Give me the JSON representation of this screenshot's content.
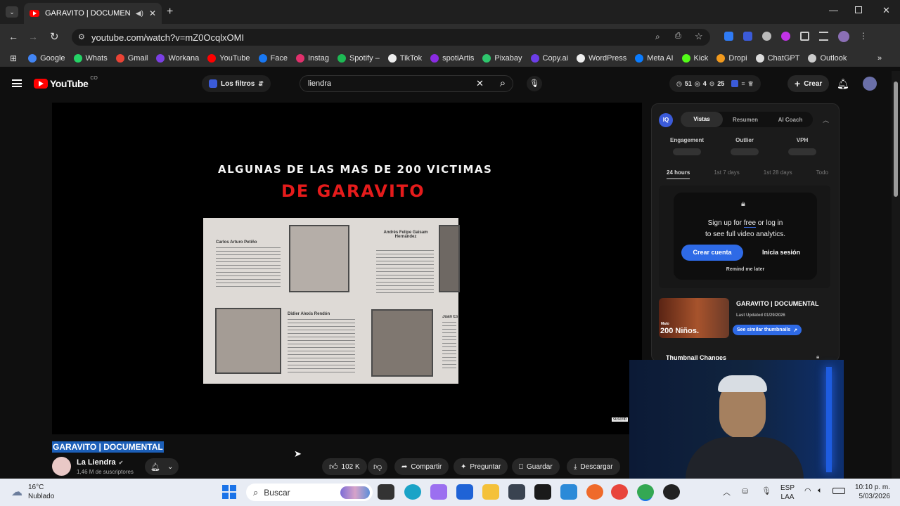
{
  "browser": {
    "tab_title": "GARAVITO | DOCUMENTAL",
    "url": "youtube.com/watch?v=mZ0OcqlxOMI",
    "bookmarks": [
      {
        "label": "Google",
        "color": "#4285f4"
      },
      {
        "label": "Whats",
        "color": "#25d366"
      },
      {
        "label": "Gmail",
        "color": "#ea4335"
      },
      {
        "label": "Workana",
        "color": "#7b3fe4"
      },
      {
        "label": "YouTube",
        "color": "#ff0000"
      },
      {
        "label": "Face",
        "color": "#1877f2"
      },
      {
        "label": "Instag",
        "color": "#e1306c"
      },
      {
        "label": "Spotify –",
        "color": "#1db954"
      },
      {
        "label": "TikTok",
        "color": "#eeeeee"
      },
      {
        "label": "spotiArtis",
        "color": "#8a2be2"
      },
      {
        "label": "Pixabay",
        "color": "#2ec66d"
      },
      {
        "label": "Copy.ai",
        "color": "#6c3ee8"
      },
      {
        "label": "WordPress",
        "color": "#eeeeee"
      },
      {
        "label": "Meta AI",
        "color": "#0a7cff"
      },
      {
        "label": "Kick",
        "color": "#53fc18"
      },
      {
        "label": "Dropi",
        "color": "#f29a1d"
      },
      {
        "label": "ChatGPT",
        "color": "#dddddd"
      },
      {
        "label": "Outlook",
        "color": "#cccccc"
      }
    ]
  },
  "youtube": {
    "logo_text": "YouTube",
    "logo_region": "CO",
    "filters_label": "Los filtros",
    "search_value": "liendra",
    "stats": {
      "a": "51",
      "b": "4",
      "c": "25"
    },
    "create_label": "Crear"
  },
  "video": {
    "overlay_line1": "ALGUNAS DE LAS MAS DE 200 VICTIMAS",
    "overlay_line2": "DE GARAVITO",
    "clip1_name": "Carlos Arturo Petiño",
    "clip2_name": "Andrés Felipe Gaisam Hernández",
    "clip3_name": "Didier Alexis Rendón",
    "clip4_name": "Juan Esteb",
    "watermark": "suscrib"
  },
  "below": {
    "title": "GARAVITO | DOCUMENTAL",
    "channel_name": "La Liendra",
    "subscribers": "1,46 M de suscriptores",
    "likes": "102 K",
    "share": "Compartir",
    "ask": "Preguntar",
    "save": "Guardar",
    "download": "Descargar"
  },
  "sidepanel": {
    "badge": "IQ",
    "tabs": [
      "Vistas",
      "Resumen",
      "AI Coach"
    ],
    "metrics": [
      "Engagement",
      "Outlier",
      "VPH"
    ],
    "ranges": [
      "24 hours",
      "1st 7 days",
      "1st 28 days",
      "Todo"
    ],
    "popup_line1_a": "Sign up for ",
    "popup_line1_b": "free",
    "popup_line1_c": " or log in",
    "popup_line2": "to see full video analytics.",
    "create_account": "Crear cuenta",
    "login": "Inicia sesión",
    "remind": "Remind me later",
    "thumb_title": "GARAVITO | DOCUMENTAL",
    "thumb_updated": "Last Updated 01/29/2026",
    "thumb_caption_small": "Mato",
    "thumb_caption": "200 Niños.",
    "similar_btn": "See similar thumbnails",
    "changes_label": "Thumbnail Changes"
  },
  "taskbar": {
    "temp": "16°C",
    "weather": "Nublado",
    "search_placeholder": "Buscar",
    "lang1": "ESP",
    "lang2": "LAA",
    "time": "10:10 p. m.",
    "date": "5/03/2026"
  }
}
